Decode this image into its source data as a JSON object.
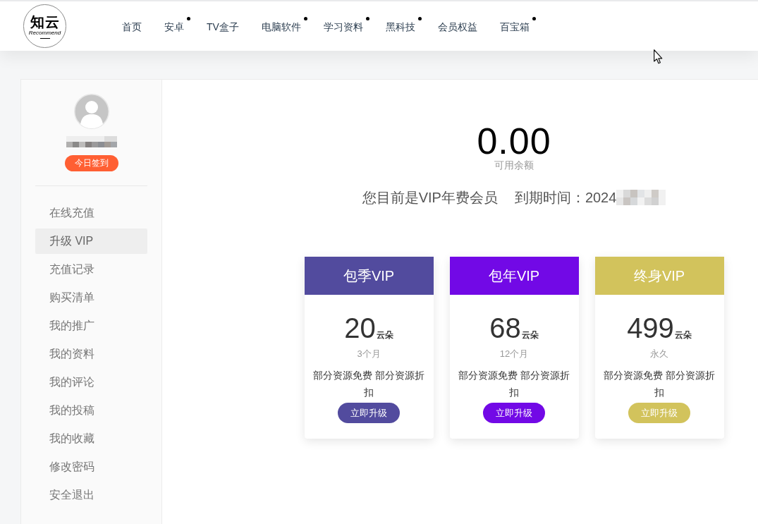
{
  "header": {
    "logo": {
      "title": "知云",
      "subtitle": "Recommend"
    },
    "nav": [
      {
        "label": "首页",
        "has_submenu": false
      },
      {
        "label": "安卓",
        "has_submenu": true
      },
      {
        "label": "TV盒子",
        "has_submenu": false
      },
      {
        "label": "电脑软件",
        "has_submenu": true
      },
      {
        "label": "学习资料",
        "has_submenu": true
      },
      {
        "label": "黑科技",
        "has_submenu": true
      },
      {
        "label": "会员权益",
        "has_submenu": false
      },
      {
        "label": "百宝箱",
        "has_submenu": true
      }
    ]
  },
  "sidebar": {
    "sign_in_button": "今日签到",
    "menu": [
      {
        "label": "在线充值",
        "selected": false
      },
      {
        "label": "升级 VIP",
        "selected": true
      },
      {
        "label": "充值记录",
        "selected": false
      },
      {
        "label": "购买清单",
        "selected": false
      },
      {
        "label": "我的推广",
        "selected": false
      },
      {
        "label": "我的资料",
        "selected": false
      },
      {
        "label": "我的评论",
        "selected": false
      },
      {
        "label": "我的投稿",
        "selected": false
      },
      {
        "label": "我的收藏",
        "selected": false
      },
      {
        "label": "修改密码",
        "selected": false
      },
      {
        "label": "安全退出",
        "selected": false
      }
    ]
  },
  "account": {
    "balance": "0.00",
    "balance_label": "可用余额",
    "membership": "您目前是VIP年费会员",
    "expiry_label": "到期时间：",
    "expiry_value": "2024"
  },
  "plans": [
    {
      "name": "包季VIP",
      "color": "#524b9e",
      "price": "20",
      "unit": "云朵",
      "period": "3个月",
      "description": "部分资源免费 部分资源折扣",
      "button": "立即升级"
    },
    {
      "name": "包年VIP",
      "color": "#7209e6",
      "price": "68",
      "unit": "云朵",
      "period": "12个月",
      "description": "部分资源免费 部分资源折扣",
      "button": "立即升级"
    },
    {
      "name": "终身VIP",
      "color": "#d2c35c",
      "price": "499",
      "unit": "云朵",
      "period": "永久",
      "description": "部分资源免费 部分资源折扣",
      "button": "立即升级"
    }
  ]
}
